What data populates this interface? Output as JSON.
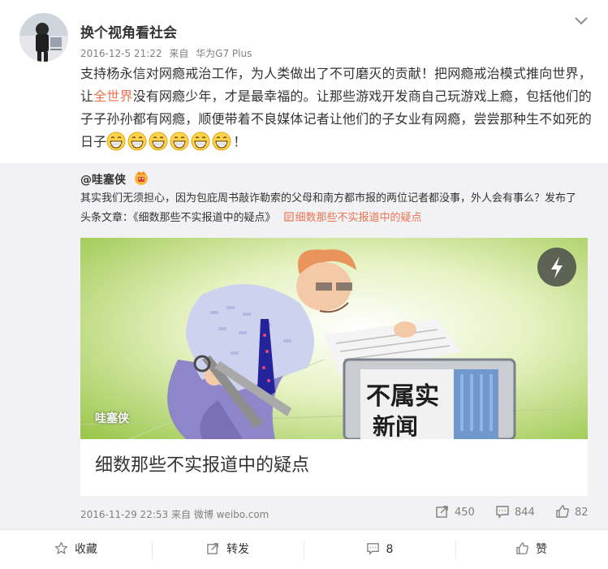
{
  "post": {
    "username": "换个视角看社会",
    "timestamp": "2016-12-5 21:22",
    "source_prefix": "来自",
    "source": "华为G7 Plus",
    "text_part1": "支持杨永信对网瘾戒治工作，为人类做出了不可磨灭的贡献！把网瘾戒治模式推向世界，让",
    "text_highlight": "全世界",
    "text_part2": "没有网瘾少年，才是最幸福的。让那些游戏开发商自己玩游戏上瘾，包括他们的子子孙孙都有网瘾，顺便带着不良媒体记者让他们的子女业有网瘾，尝尝那种生不如死的日子",
    "text_end": "！",
    "emoji_name": "grin-emoji",
    "emoji_count": 6
  },
  "repost": {
    "username": "@哇塞侠",
    "badge_icon": "vip-badge-icon",
    "text": "其实我们无须担心，因为包庇周书敲诈勒索的父母和南方都市报的两位记者都没事，外人会有事么？发布了头条文章：《细数那些不实报道中的疑点》",
    "link_label": "细数那些不实报道中的疑点",
    "article": {
      "image_caption": "哇塞侠",
      "sign_text": "不属实",
      "sign_text2": "新闻",
      "title": "细数那些不实报道中的疑点"
    },
    "timestamp": "2016-11-29 22:53",
    "source_prefix": "来自",
    "source": "微博 weibo.com",
    "reposts": "450",
    "comments": "844",
    "likes": "82"
  },
  "actions": {
    "favorite": "收藏",
    "repost": "转发",
    "comments": "8",
    "like": "赞"
  },
  "colors": {
    "highlight": "#eb7350",
    "meta": "#808080",
    "repost_bg": "#f2f2f5"
  }
}
